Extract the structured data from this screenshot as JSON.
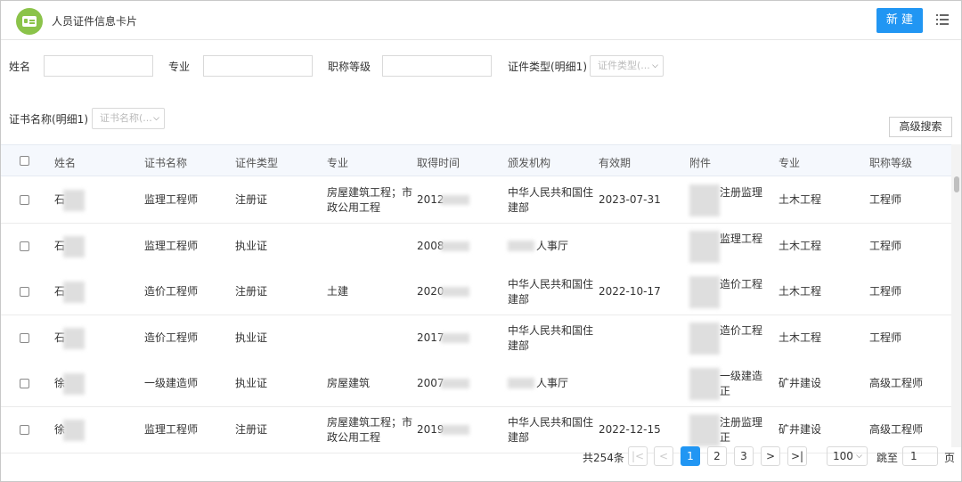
{
  "header": {
    "title": "人员证件信息卡片",
    "new_label": "新 建"
  },
  "filters": {
    "name_label": "姓名",
    "major_label": "专业",
    "rank_label": "职称等级",
    "cert_type_label": "证件类型(明细1)",
    "cert_type_placeholder": "证件类型(...",
    "cert_name_label": "证书名称(明细1)",
    "cert_name_placeholder": "证书名称(...",
    "advanced_label": "高级搜索"
  },
  "table": {
    "columns": [
      "姓名",
      "证书名称",
      "证件类型",
      "专业",
      "取得时间",
      "颁发机构",
      "有效期",
      "附件",
      "专业",
      "职称等级"
    ],
    "rows": [
      {
        "name": "石",
        "cert": "监理工程师",
        "type": "注册证",
        "major1": "房屋建筑工程；市",
        "major2": "政公用工程",
        "year": "2012",
        "org1": "中华人民共和国住",
        "org2": "建部",
        "valid": "2023-07-31",
        "att1": "注册监理",
        "att2": "",
        "field": "土木工程",
        "rank": "工程师"
      },
      {
        "name": "石",
        "cert": "监理工程师",
        "type": "执业证",
        "major1": "",
        "major2": "",
        "year": "2008",
        "org1": "人事厅",
        "org2": "",
        "valid": "",
        "att1": "监理工程",
        "att2": "",
        "field": "土木工程",
        "rank": "工程师"
      },
      {
        "name": "石",
        "cert": "造价工程师",
        "type": "注册证",
        "major1": "土建",
        "major2": "",
        "year": "2020",
        "org1": "中华人民共和国住",
        "org2": "建部",
        "valid": "2022-10-17",
        "att1": "造价工程",
        "att2": "",
        "field": "土木工程",
        "rank": "工程师"
      },
      {
        "name": "石",
        "cert": "造价工程师",
        "type": "执业证",
        "major1": "",
        "major2": "",
        "year": "2017",
        "org1": "中华人民共和国住",
        "org2": "建部",
        "valid": "",
        "att1": "造价工程",
        "att2": "",
        "field": "土木工程",
        "rank": "工程师"
      },
      {
        "name": "徐",
        "cert": "一级建造师",
        "type": "执业证",
        "major1": "房屋建筑",
        "major2": "",
        "year": "2007",
        "org1": "人事厅",
        "org2": "",
        "valid": "",
        "att1": "一级建造",
        "att2": "正",
        "field": "矿井建设",
        "rank": "高级工程师"
      },
      {
        "name": "徐",
        "cert": "监理工程师",
        "type": "注册证",
        "major1": "房屋建筑工程；市",
        "major2": "政公用工程",
        "year": "2019",
        "org1": "中华人民共和国住",
        "org2": "建部",
        "valid": "2022-12-15",
        "att1": "注册监理",
        "att2": "正",
        "field": "矿井建设",
        "rank": "高级工程师"
      }
    ]
  },
  "pagination": {
    "total": "共254条",
    "first": "|<",
    "prev": "<",
    "p1": "1",
    "p2": "2",
    "p3": "3",
    "next": ">",
    "last": ">|",
    "size": "100",
    "jump_label": "跳至",
    "jump_value": "1",
    "page_unit": "页"
  }
}
